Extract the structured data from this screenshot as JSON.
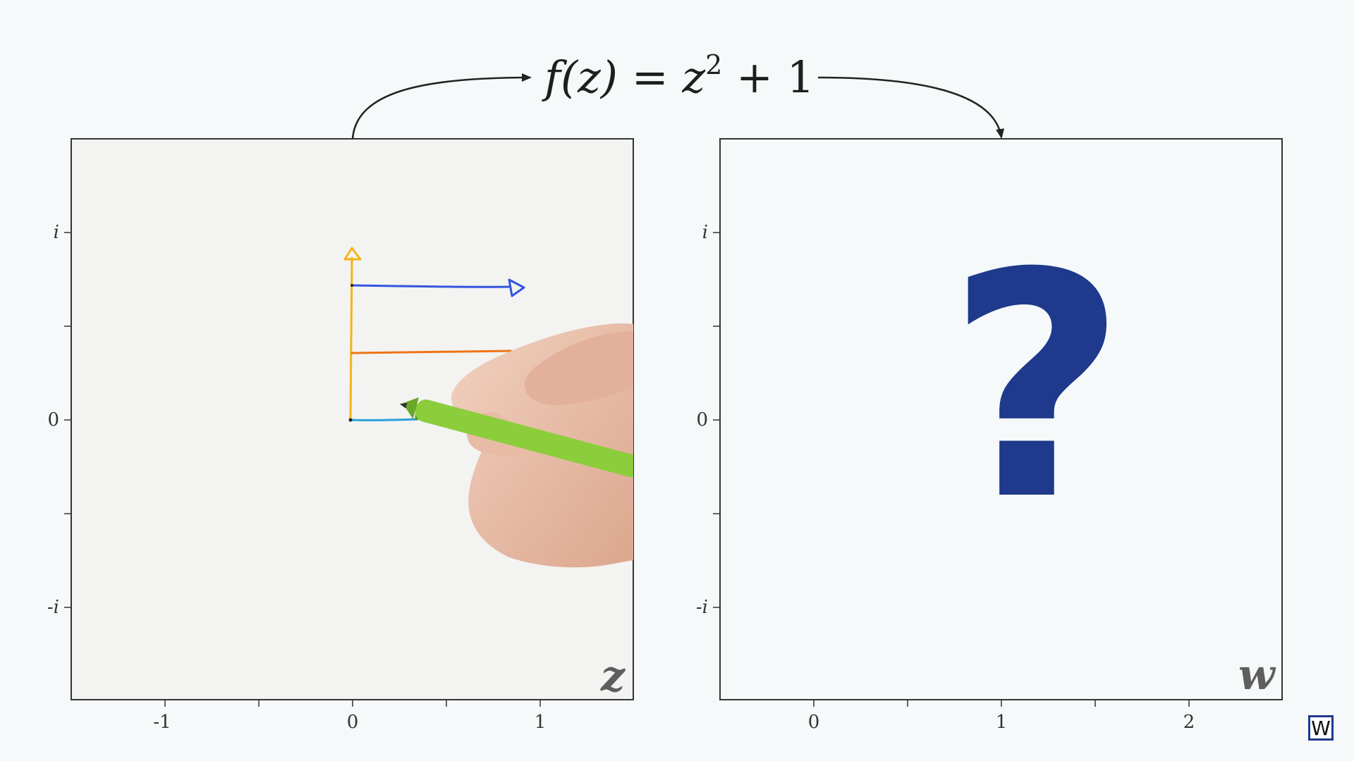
{
  "formula": {
    "lhs": "f(z)",
    "equals": "=",
    "base": "z",
    "exponent": "2",
    "rest": "+ 1"
  },
  "left_panel": {
    "label": "z",
    "x_ticks": [
      "-1",
      "0",
      "1"
    ],
    "y_ticks": [
      "i",
      "0",
      "-i"
    ]
  },
  "right_panel": {
    "label": "w",
    "x_ticks": [
      "0",
      "1",
      "2"
    ],
    "y_ticks": [
      "i",
      "0",
      "-i"
    ],
    "placeholder": "?"
  },
  "badge": {
    "text": "W"
  },
  "colors": {
    "vertical_stroke": "#f4b41a",
    "top_stroke": "#3355dd",
    "middle_stroke": "#f07318",
    "bottom_stroke": "#2aa0dc",
    "question": "#1f3a8c",
    "pen": "#8ccd3c"
  }
}
